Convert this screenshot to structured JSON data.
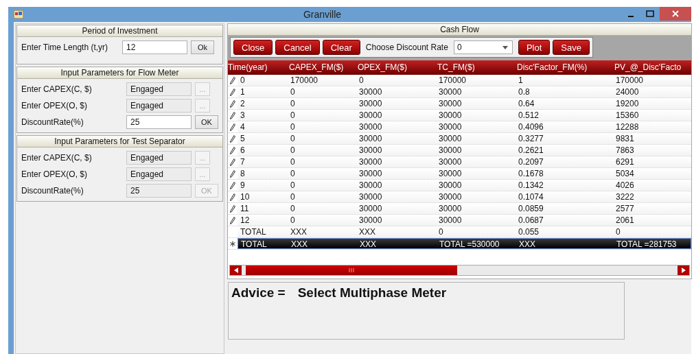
{
  "window": {
    "title": "Granville"
  },
  "groups": [
    {
      "title": "Period of Investment",
      "rows": [
        {
          "kind": "entry",
          "label": "Enter Time Length (t,yr)",
          "value": "12",
          "button": "Ok",
          "disabled": false
        }
      ]
    },
    {
      "title": "Input Parameters for Flow Meter",
      "rows": [
        {
          "kind": "browse",
          "label": "Enter CAPEX(C, $)",
          "value": "Engaged",
          "button": "...",
          "disabled": true
        },
        {
          "kind": "browse",
          "label": "Enter OPEX(O, $)",
          "value": "Engaged",
          "button": "...",
          "disabled": true
        },
        {
          "kind": "entry",
          "label": "DiscountRate(%)",
          "value": "25",
          "button": "OK",
          "disabled": false
        }
      ]
    },
    {
      "title": "Input Parameters for Test Separator",
      "rows": [
        {
          "kind": "browse",
          "label": "Enter CAPEX(C, $)",
          "value": "Engaged",
          "button": "...",
          "disabled": true
        },
        {
          "kind": "browse",
          "label": "Enter OPEX(O, $)",
          "value": "Engaged",
          "button": "...",
          "disabled": true
        },
        {
          "kind": "entry",
          "label": "DiscountRate(%)",
          "value": "25",
          "button": "OK",
          "disabled": true
        }
      ]
    }
  ],
  "cash_flow": {
    "title": "Cash Flow",
    "toolbar": [
      {
        "kind": "button",
        "text": "Close"
      },
      {
        "kind": "button",
        "text": "Cancel"
      },
      {
        "kind": "button",
        "text": "Clear"
      },
      {
        "kind": "label",
        "text": "Choose Discount Rate"
      },
      {
        "kind": "dropdown",
        "text": "0"
      },
      {
        "kind": "button",
        "text": "Plot"
      },
      {
        "kind": "button",
        "text": "Save"
      }
    ],
    "columns": [
      "Time(year)",
      "CAPEX_FM($)",
      "OPEX_FM($)",
      "TC_FM($)",
      "Disc'Factor_FM(%)",
      "PV_@_Disc'Facto"
    ],
    "rows": [
      {
        "kind": "edit",
        "selected": false,
        "cells": [
          "0",
          "170000",
          "0",
          "170000",
          "1",
          "170000"
        ]
      },
      {
        "kind": "edit",
        "selected": false,
        "cells": [
          "1",
          "0",
          "30000",
          "30000",
          "0.8",
          "24000"
        ]
      },
      {
        "kind": "edit",
        "selected": false,
        "cells": [
          "2",
          "0",
          "30000",
          "30000",
          "0.64",
          "19200"
        ]
      },
      {
        "kind": "edit",
        "selected": false,
        "cells": [
          "3",
          "0",
          "30000",
          "30000",
          "0.512",
          "15360"
        ]
      },
      {
        "kind": "edit",
        "selected": false,
        "cells": [
          "4",
          "0",
          "30000",
          "30000",
          "0.4096",
          "12288"
        ]
      },
      {
        "kind": "edit",
        "selected": false,
        "cells": [
          "5",
          "0",
          "30000",
          "30000",
          "0.3277",
          "9831"
        ]
      },
      {
        "kind": "edit",
        "selected": false,
        "cells": [
          "6",
          "0",
          "30000",
          "30000",
          "0.2621",
          "7863"
        ]
      },
      {
        "kind": "edit",
        "selected": false,
        "cells": [
          "7",
          "0",
          "30000",
          "30000",
          "0.2097",
          "6291"
        ]
      },
      {
        "kind": "edit",
        "selected": false,
        "cells": [
          "8",
          "0",
          "30000",
          "30000",
          "0.1678",
          "5034"
        ]
      },
      {
        "kind": "edit",
        "selected": false,
        "cells": [
          "9",
          "0",
          "30000",
          "30000",
          "0.1342",
          "4026"
        ]
      },
      {
        "kind": "edit",
        "selected": false,
        "cells": [
          "10",
          "0",
          "30000",
          "30000",
          "0.1074",
          "3222"
        ]
      },
      {
        "kind": "edit",
        "selected": false,
        "cells": [
          "11",
          "0",
          "30000",
          "30000",
          "0.0859",
          "2577"
        ]
      },
      {
        "kind": "edit",
        "selected": false,
        "cells": [
          "12",
          "0",
          "30000",
          "30000",
          "0.0687",
          "2061"
        ]
      },
      {
        "kind": "plain",
        "selected": false,
        "cells": [
          "TOTAL",
          "XXX",
          "XXX",
          "0",
          "0.055",
          "0"
        ]
      },
      {
        "kind": "new",
        "selected": true,
        "cells": [
          "TOTAL",
          "XXX",
          "XXX",
          "TOTAL =530000",
          "XXX",
          "TOTAL =281753"
        ]
      }
    ]
  },
  "advice": {
    "label": "Advice =",
    "value": "Select Multiphase Meter"
  }
}
